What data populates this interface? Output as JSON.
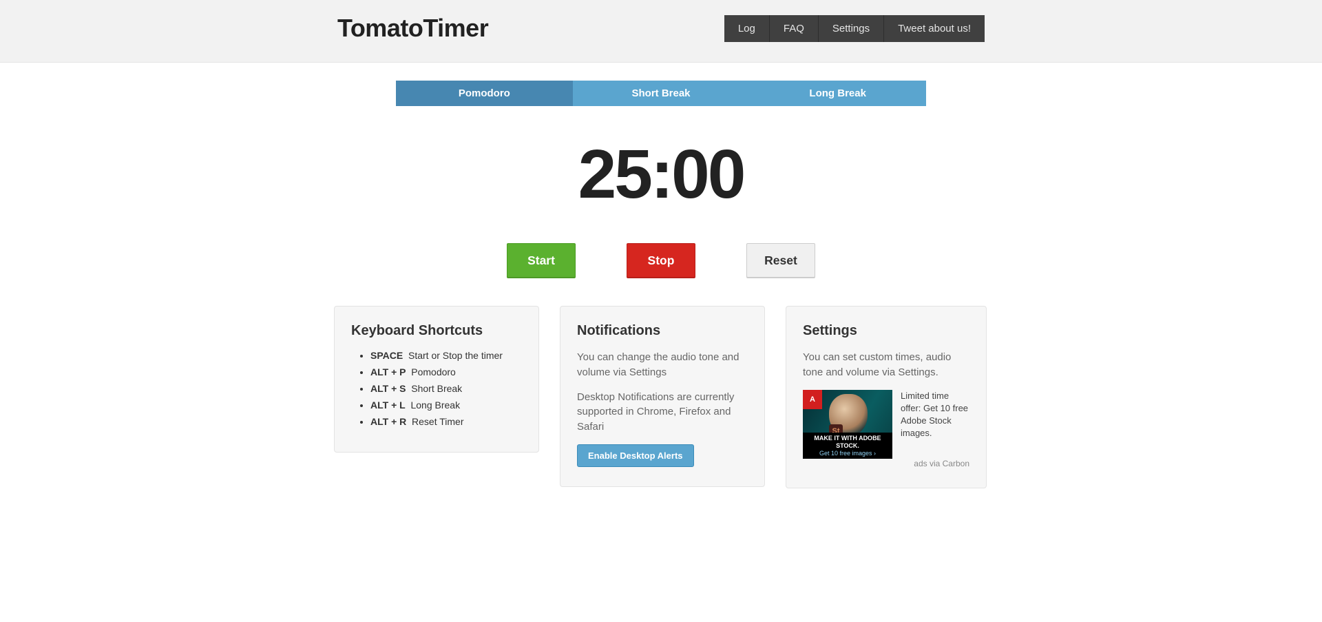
{
  "header": {
    "brand": "TomatoTimer",
    "nav": [
      "Log",
      "FAQ",
      "Settings",
      "Tweet about us!"
    ]
  },
  "tabs": [
    {
      "label": "Pomodoro",
      "active": true
    },
    {
      "label": "Short Break",
      "active": false
    },
    {
      "label": "Long Break",
      "active": false
    }
  ],
  "timer_display": "25:00",
  "controls": {
    "start": "Start",
    "stop": "Stop",
    "reset": "Reset"
  },
  "shortcuts": {
    "title": "Keyboard Shortcuts",
    "items": [
      {
        "key": "SPACE",
        "desc": "Start or Stop the timer"
      },
      {
        "key": "ALT + P",
        "desc": "Pomodoro"
      },
      {
        "key": "ALT + S",
        "desc": "Short Break"
      },
      {
        "key": "ALT + L",
        "desc": "Long Break"
      },
      {
        "key": "ALT + R",
        "desc": "Reset Timer"
      }
    ]
  },
  "notifications": {
    "title": "Notifications",
    "line1": "You can change the audio tone and volume via Settings",
    "line2": "Desktop Notifications are currently supported in Chrome, Firefox and Safari",
    "button": "Enable Desktop Alerts"
  },
  "settings": {
    "title": "Settings",
    "desc": "You can set custom times, audio tone and volume via Settings.",
    "ad_text": "Limited time offer: Get 10 free Adobe Stock images.",
    "ad_via": "ads via Carbon",
    "ad_img_headline": "MAKE IT WITH ADOBE STOCK.",
    "ad_img_sub": "Get 10 free images ›"
  }
}
